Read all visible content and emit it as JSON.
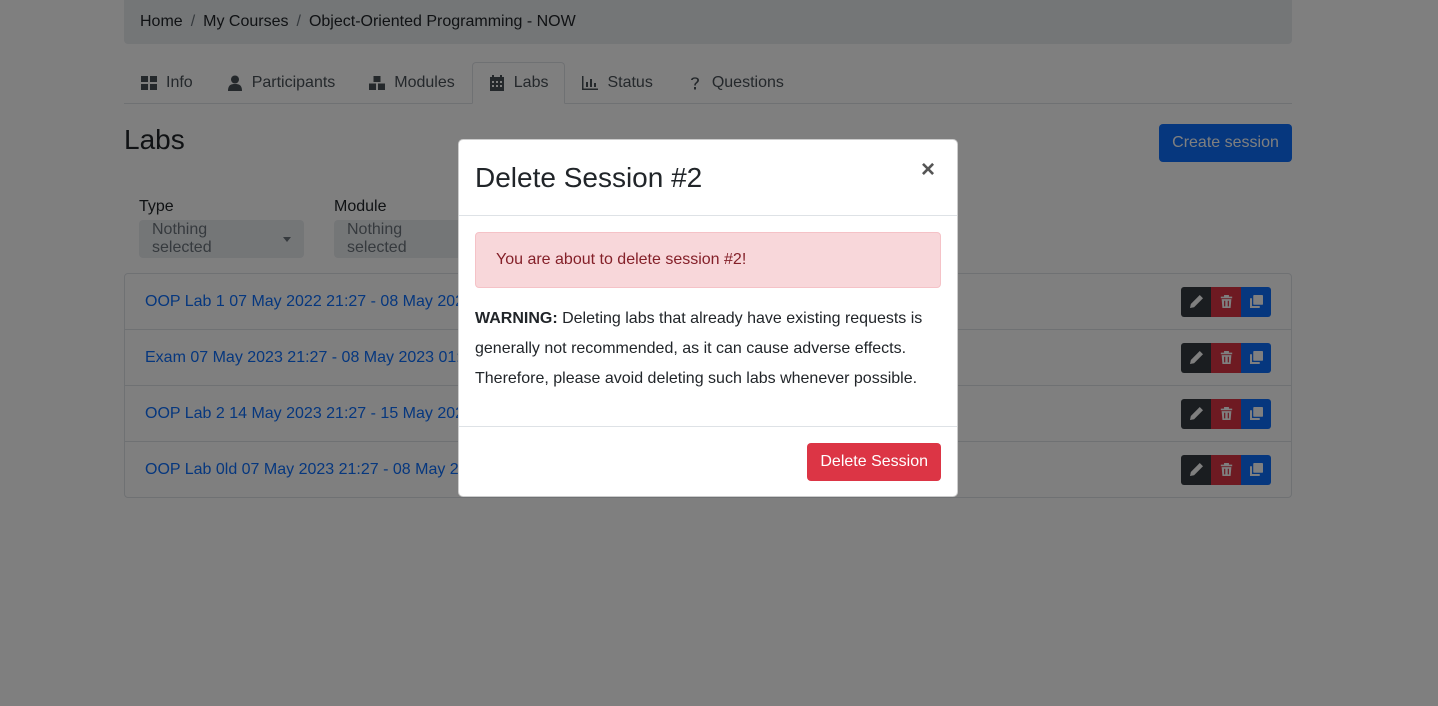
{
  "breadcrumb": {
    "home": "Home",
    "sep": "/",
    "courses": "My Courses",
    "current": "Object-Oriented Programming - NOW"
  },
  "tabs": [
    {
      "label": "Info",
      "icon": "grid-icon"
    },
    {
      "label": "Participants",
      "icon": "user-icon"
    },
    {
      "label": "Modules",
      "icon": "cubes-icon"
    },
    {
      "label": "Labs",
      "icon": "calendar-icon",
      "active": true
    },
    {
      "label": "Status",
      "icon": "chart-icon"
    },
    {
      "label": "Questions",
      "icon": "question-icon"
    }
  ],
  "page": {
    "title": "Labs",
    "create_label": "Create session"
  },
  "filters": {
    "type_label": "Type",
    "type_value": "Nothing selected",
    "module_label": "Module",
    "module_value": "Nothing selected"
  },
  "sessions": [
    {
      "name": "OOP Lab 1 07 May 2022 21:27 - 08 May 2022 01:27"
    },
    {
      "name": "Exam 07 May 2023 21:27 - 08 May 2023 01:27"
    },
    {
      "name": "OOP Lab 2 14 May 2023 21:27 - 15 May 2023 01:27"
    },
    {
      "name": "OOP Lab 0ld 07 May 2023 21:27 - 08 May 2023 01:27"
    }
  ],
  "modal": {
    "title": "Delete Session #2",
    "close": "×",
    "alert": "You are about to delete session #2!",
    "warning_bold": "WARNING:",
    "warning_text": " Deleting labs that already have existing requests is generally not recommended, as it can cause adverse effects. Therefore, please avoid deleting such labs whenever possible.",
    "confirm_label": "Delete Session"
  },
  "colors": {
    "primary": "#0d6efd",
    "danger": "#dc3545",
    "dark": "#343a40",
    "alert_bg": "#f8d7da",
    "alert_text": "#842029"
  }
}
